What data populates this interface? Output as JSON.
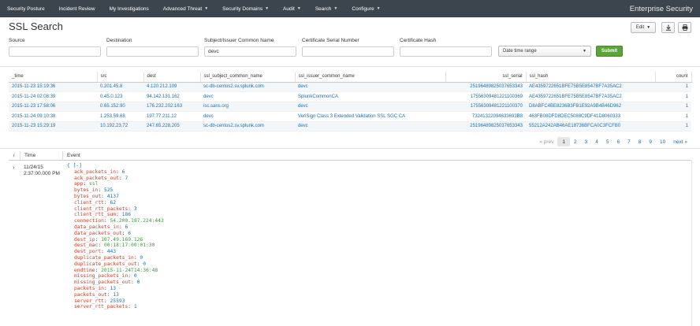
{
  "nav": {
    "items": [
      {
        "label": "Security Posture",
        "dropdown": false
      },
      {
        "label": "Incident Review",
        "dropdown": false
      },
      {
        "label": "My Investigations",
        "dropdown": false
      },
      {
        "label": "Advanced Threat",
        "dropdown": true
      },
      {
        "label": "Security Domains",
        "dropdown": true
      },
      {
        "label": "Audit",
        "dropdown": true
      },
      {
        "label": "Search",
        "dropdown": true
      },
      {
        "label": "Configure",
        "dropdown": true
      }
    ],
    "brand": "Enterprise Security"
  },
  "page": {
    "title": "SSL Search",
    "edit_label": "Edit",
    "export_icon": "download-icon",
    "print_icon": "print-icon"
  },
  "filters": {
    "source": {
      "label": "Source",
      "value": ""
    },
    "destination": {
      "label": "Destination",
      "value": ""
    },
    "subject": {
      "label": "Subject/Issuer Common Name",
      "value": "devc"
    },
    "serial": {
      "label": "Certificate Serial Number",
      "value": ""
    },
    "hash": {
      "label": "Certificate Hash",
      "value": ""
    },
    "time_range": "Date time range",
    "submit_label": "Submit"
  },
  "results": {
    "columns": [
      "_time",
      "src",
      "dest",
      "ssl_subject_common_name",
      "ssl_issuer_common_name",
      "ssl_serial",
      "ssl_hash",
      "count"
    ],
    "rows": [
      [
        "2015-11-23 15:19:36",
        "0.201.45.8",
        "4.120.212.109",
        "sc-db-centos2.sv.splunk.com",
        "devc",
        "25196489825037653343",
        "AE4359722651BFE75B5E8547BF7A35AC2",
        "1"
      ],
      [
        "2015-11-24 02:08:39",
        "0.45.0.123",
        "94.142.131.162",
        "devc",
        "SplunkCommonCA",
        "17556309481221100369",
        "AE4359722651BFE75B5E8547BF7A35AC2",
        "1"
      ],
      [
        "2015-11-23 17:58:06",
        "0.65.152.90",
        "176.232.202.163",
        "isc.sans.org",
        "devc",
        "17556309481221100370",
        "D8ABFC4BE8236B3FB1E92A9B4B46D962",
        "1"
      ],
      [
        "2015-11-24 09:10:38",
        "1.253.59.68",
        "197.77.211.12",
        "devc",
        "VeriSign Class 3 Extended Validation SSL SGC CA",
        "73241322094633693B8",
        "463FB08DFD8DEC5088C9DF41D8060333",
        "1"
      ],
      [
        "2015-11-23 15:29:19",
        "10.192.23.72",
        "247.65.228.205",
        "sc-db-centos2.sv.splunk.com",
        "devc",
        "25196489825037653343",
        "55212A242AB46AE18736BFCA0C3FCFB0",
        "1"
      ]
    ]
  },
  "pager": {
    "prev": "« prev",
    "pages": [
      "1",
      "2",
      "3",
      "4",
      "5",
      "6",
      "7",
      "8",
      "9",
      "10"
    ],
    "current": "1",
    "next": "next »"
  },
  "events": {
    "col_info": "i",
    "col_time": "Time",
    "col_event": "Event",
    "time_date": "11/24/15",
    "time_clock": "2:37:00.000 PM",
    "open": "{ [-]",
    "fields": [
      {
        "k": "ack_packets_in",
        "v": "6",
        "t": "n"
      },
      {
        "k": "ack_packets_out",
        "v": "7",
        "t": "n"
      },
      {
        "k": "app",
        "v": "ssl",
        "t": "s"
      },
      {
        "k": "bytes_in",
        "v": "525",
        "t": "n"
      },
      {
        "k": "bytes_out",
        "v": "4137",
        "t": "n"
      },
      {
        "k": "client_rtt",
        "v": "62",
        "t": "n"
      },
      {
        "k": "client_rtt_packets",
        "v": "3",
        "t": "n"
      },
      {
        "k": "client_rtt_sum",
        "v": "186",
        "t": "n"
      },
      {
        "k": "connection",
        "v": "54.200.187.224:443",
        "t": "s"
      },
      {
        "k": "data_packets_in",
        "v": "6",
        "t": "n"
      },
      {
        "k": "data_packets_out",
        "v": "6",
        "t": "n"
      },
      {
        "k": "dest_ip",
        "v": "107.49.169.126",
        "t": "s"
      },
      {
        "k": "dest_mac",
        "v": "00:18:17:00:01:30",
        "t": "s"
      },
      {
        "k": "dest_port",
        "v": "443",
        "t": "n"
      },
      {
        "k": "duplicate_packets_in",
        "v": "0",
        "t": "n"
      },
      {
        "k": "duplicate_packets_out",
        "v": "0",
        "t": "n"
      },
      {
        "k": "endtime",
        "v": "2015-11-24T14:36:48",
        "t": "s"
      },
      {
        "k": "missing_packets_in",
        "v": "0",
        "t": "n"
      },
      {
        "k": "missing_packets_out",
        "v": "0",
        "t": "n"
      },
      {
        "k": "packets_in",
        "v": "13",
        "t": "n"
      },
      {
        "k": "packets_out",
        "v": "13",
        "t": "n"
      },
      {
        "k": "server_rtt",
        "v": "25593",
        "t": "n"
      },
      {
        "k": "server_rtt_packets",
        "v": "1",
        "t": "n"
      }
    ]
  },
  "colors": {
    "nav_bg": "#3c444d",
    "link": "#1a6fb0",
    "submit": "#5ca33a",
    "json_key": "#c7402a",
    "json_string": "#3a9a3a"
  }
}
